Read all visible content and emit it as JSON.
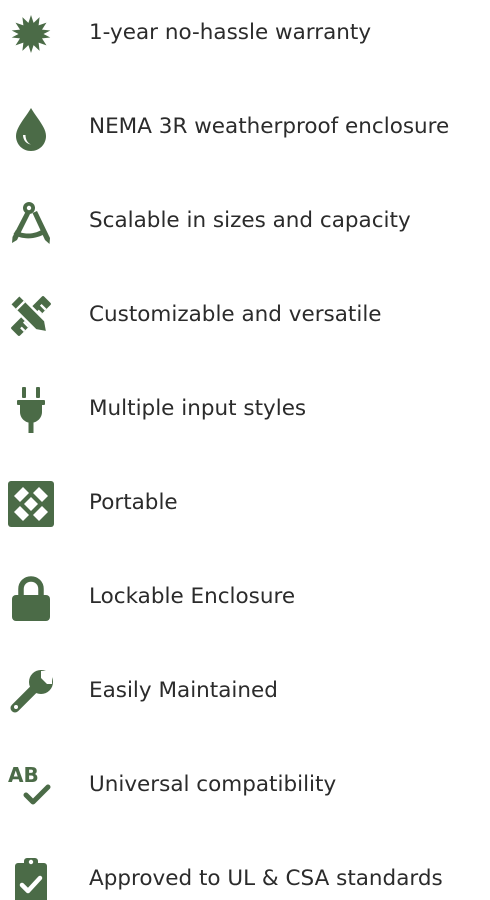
{
  "colors": {
    "icon": "#4b6b47",
    "text": "#2b2b2b",
    "background": "#ffffff"
  },
  "features": [
    {
      "icon": "certificate-seal-icon",
      "label": "1-year no-hassle warranty"
    },
    {
      "icon": "water-drop-icon",
      "label": "NEMA 3R weatherproof enclosure"
    },
    {
      "icon": "compass-drafting-icon",
      "label": "Scalable in sizes and capacity"
    },
    {
      "icon": "pencil-ruler-icon",
      "label": "Customizable and versatile"
    },
    {
      "icon": "power-plug-icon",
      "label": "Multiple input styles"
    },
    {
      "icon": "expand-arrows-icon",
      "label": "Portable"
    },
    {
      "icon": "padlock-icon",
      "label": "Lockable Enclosure"
    },
    {
      "icon": "wrench-icon",
      "label": "Easily Maintained"
    },
    {
      "icon": "spell-check-icon",
      "label": "Universal compatibility"
    },
    {
      "icon": "clipboard-check-icon",
      "label": "Approved to UL & CSA standards"
    }
  ]
}
